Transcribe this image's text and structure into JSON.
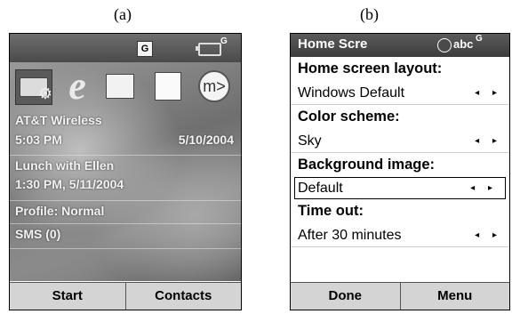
{
  "captions": {
    "a": "(a)",
    "b": "(b)"
  },
  "phone_a": {
    "status": {
      "signal_badge": "G",
      "battery_badge": "G"
    },
    "icons": [
      "settings-folder-icon",
      "internet-explorer-icon",
      "calendar-icon",
      "notes-icon",
      "messenger-icon"
    ],
    "messenger_glyph": "m>",
    "items": {
      "carrier": "AT&T Wireless",
      "time": "5:03 PM",
      "date": "5/10/2004",
      "appointment": "Lunch with Ellen",
      "appointment_time": "1:30 PM, 5/11/2004",
      "profile": "Profile: Normal",
      "sms": "SMS (0)"
    },
    "softkeys": {
      "left": "Start",
      "right": "Contacts"
    }
  },
  "phone_b": {
    "status": {
      "title": "Home Scre",
      "input_mode": "abc",
      "battery_badge": "G"
    },
    "settings": [
      {
        "heading": "Home screen layout:",
        "value": "Windows Default"
      },
      {
        "heading": "Color scheme:",
        "value": "Sky"
      },
      {
        "heading": "Background image:",
        "value": "Default",
        "selected": true
      },
      {
        "heading": "Time out:",
        "value": "After 30 minutes"
      }
    ],
    "arrows": "◂ ▸",
    "softkeys": {
      "left": "Done",
      "right": "Menu"
    }
  }
}
